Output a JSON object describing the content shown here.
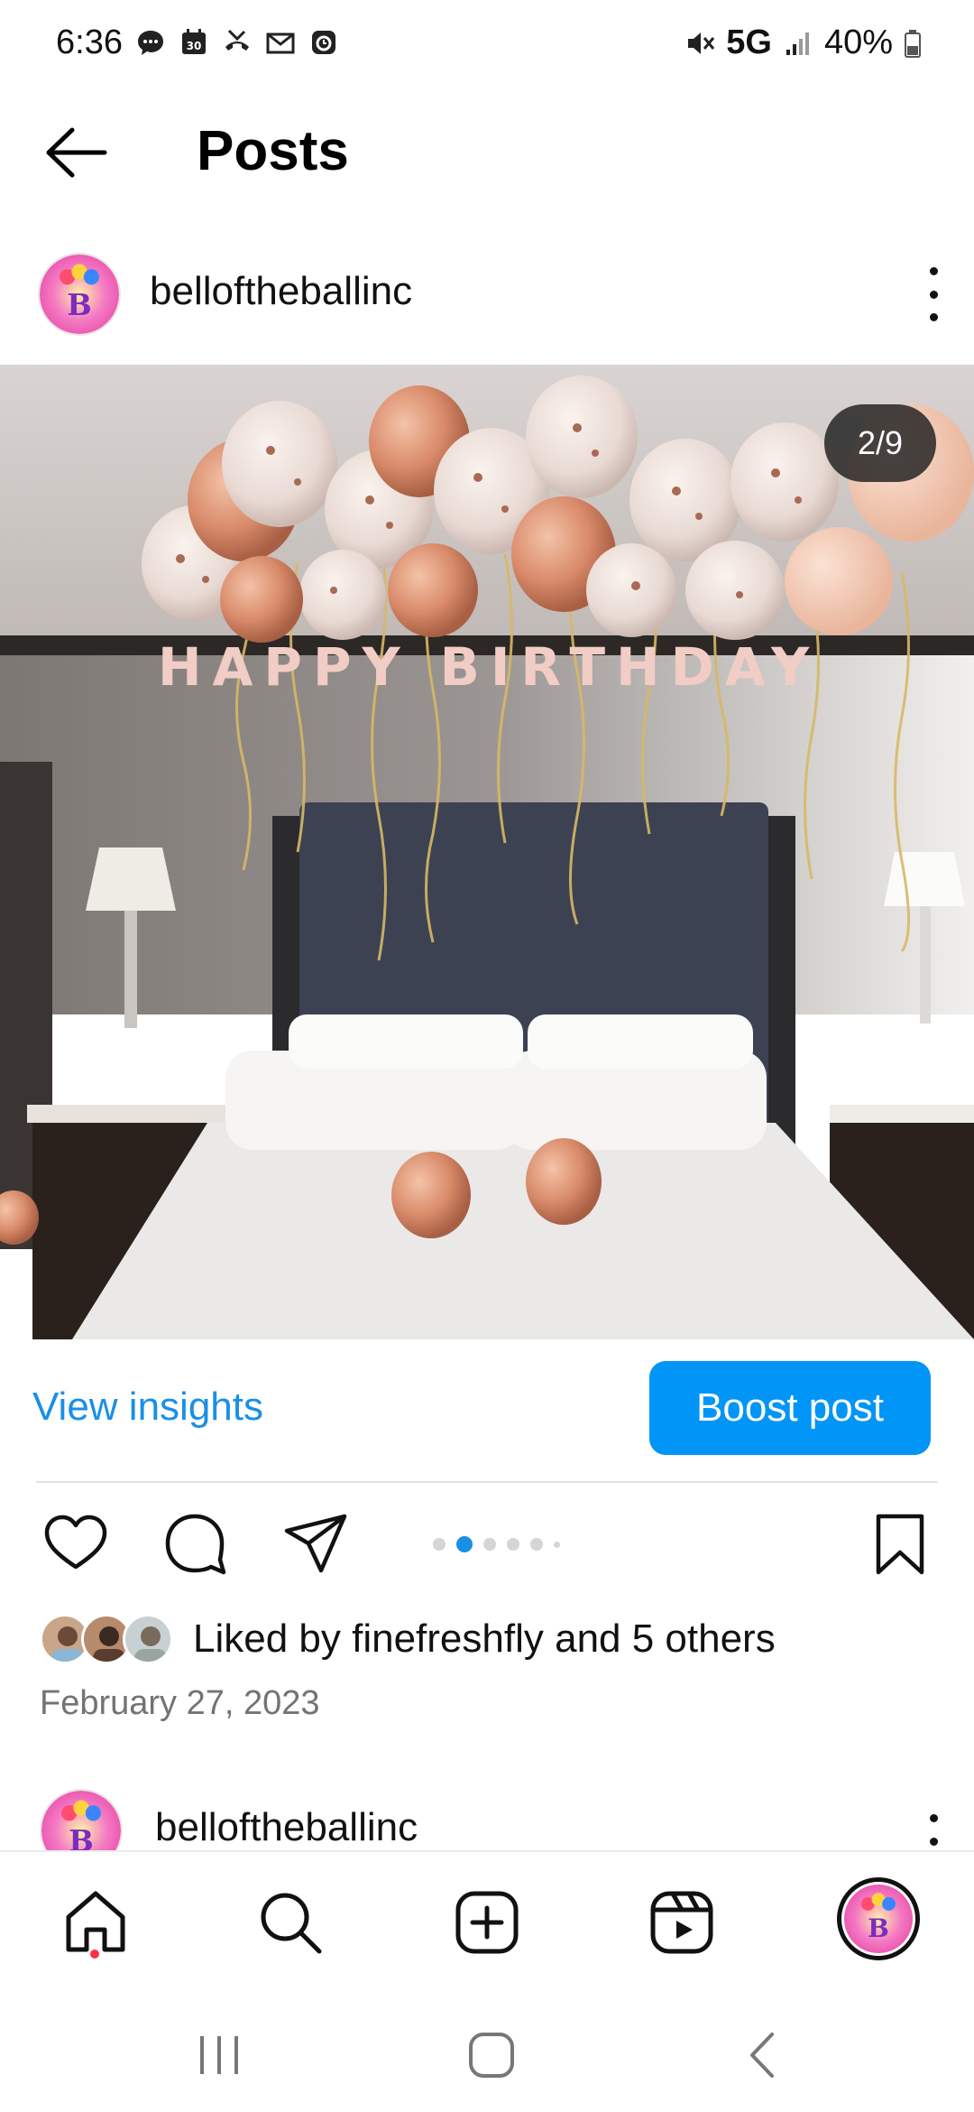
{
  "status_bar": {
    "time": "6:36",
    "network": "5G",
    "battery": "40%",
    "left_icons": [
      "chat-bubble-icon",
      "calendar-icon",
      "missed-call-icon",
      "gmail-icon",
      "alarm-app-icon"
    ],
    "right_icons": [
      "mute-icon",
      "signal-icon",
      "battery-icon"
    ]
  },
  "header": {
    "title": "Posts"
  },
  "post": {
    "username": "belloftheballinc",
    "image_counter": "2/9",
    "photo_subject": "hotel bed decorated with rose gold and confetti balloons and a HAPPY BIRTHDAY banner",
    "view_insights_label": "View insights",
    "boost_label": "Boost post",
    "carousel": {
      "total_dots": 6,
      "active_index": 1
    },
    "likes_text": "Liked by finefreshfly and 5 others",
    "date": "February 27, 2023"
  },
  "next_post": {
    "username": "belloftheballinc"
  },
  "bottom_nav": {
    "items": [
      "home-icon",
      "search-icon",
      "create-icon",
      "reels-icon",
      "profile-avatar"
    ]
  },
  "colors": {
    "accent_blue": "#0095f6",
    "link_blue": "#1a8fe6",
    "notification_red": "#ff3040",
    "text_gray": "#737373"
  }
}
